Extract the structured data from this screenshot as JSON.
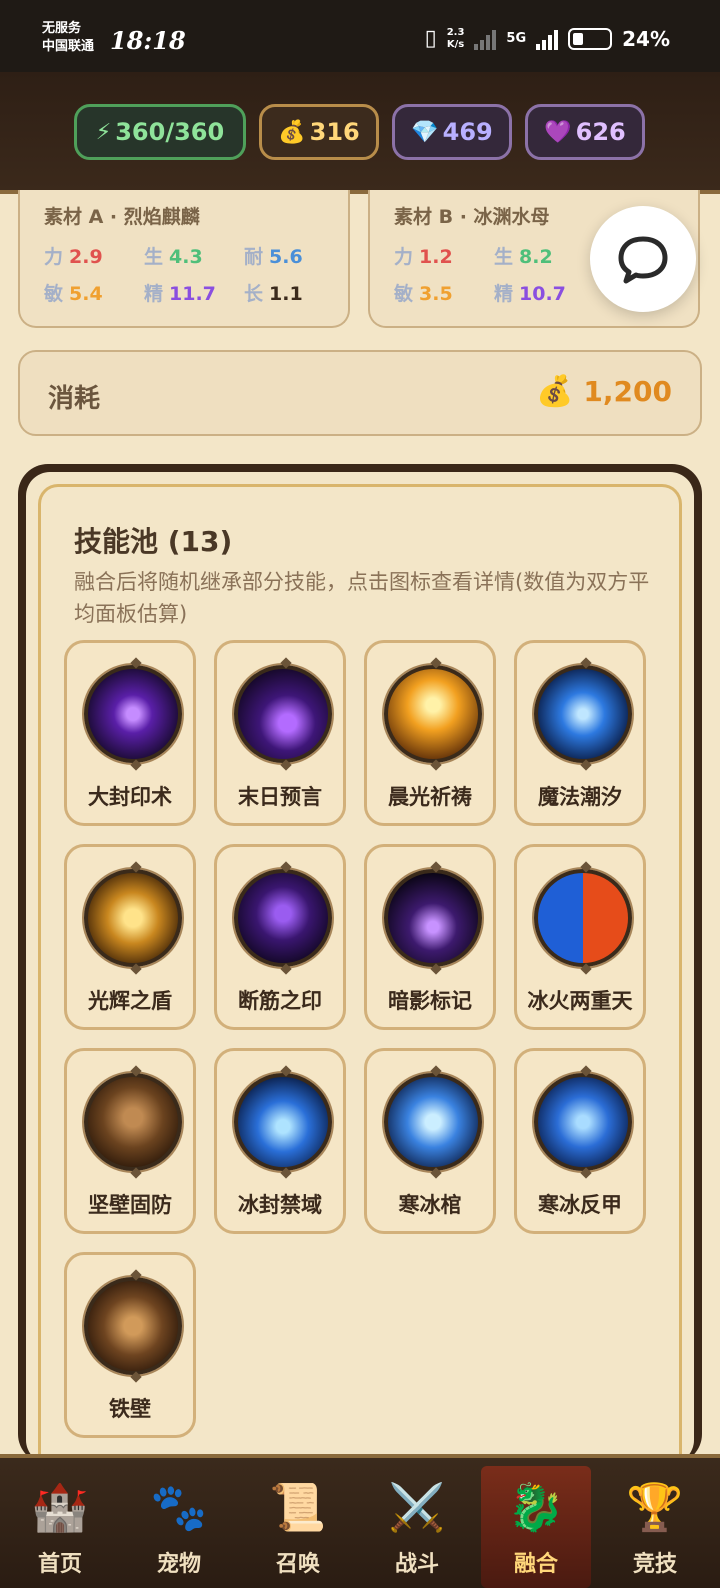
{
  "status_bar": {
    "carrier_line1": "无服务",
    "carrier_line2": "中国联通",
    "time": "18:18",
    "net_speed_value": "2.3",
    "net_speed_unit": "K/s",
    "network_type": "5G",
    "battery": "24%"
  },
  "resources": {
    "energy": {
      "icon": "⚡",
      "value": "360/360"
    },
    "gold": {
      "icon": "💰",
      "value": "316"
    },
    "diamond": {
      "icon": "💎",
      "value": "469"
    },
    "gem": {
      "icon": "💜",
      "value": "626"
    }
  },
  "materials": {
    "a": {
      "title": "素材 A · 烈焰麒麟",
      "stats": [
        {
          "label": "力",
          "value": "2.9"
        },
        {
          "label": "生",
          "value": "4.3"
        },
        {
          "label": "耐",
          "value": "5.6"
        },
        {
          "label": "敏",
          "value": "5.4"
        },
        {
          "label": "精",
          "value": "11.7"
        },
        {
          "label": "长",
          "value": "1.1"
        }
      ]
    },
    "b": {
      "title": "素材 B · 冰渊水母",
      "stats": [
        {
          "label": "力",
          "value": "1.2"
        },
        {
          "label": "生",
          "value": "8.2"
        },
        {
          "label": "敏",
          "value": "3.5"
        },
        {
          "label": "精",
          "value": "10.7"
        }
      ]
    }
  },
  "cost": {
    "label": "消耗",
    "icon": "💰",
    "value": "1,200"
  },
  "skill_pool": {
    "title": "技能池 (13)",
    "description": "融合后将随机继承部分技能，点击图标查看详情(数值为双方平均面板估算)",
    "skills": [
      {
        "name": "大封印术"
      },
      {
        "name": "末日预言"
      },
      {
        "name": "晨光祈祷"
      },
      {
        "name": "魔法潮汐"
      },
      {
        "name": "光辉之盾"
      },
      {
        "name": "断筋之印"
      },
      {
        "name": "暗影标记"
      },
      {
        "name": "冰火两重天"
      },
      {
        "name": "坚壁固防"
      },
      {
        "name": "冰封禁域"
      },
      {
        "name": "寒冰棺"
      },
      {
        "name": "寒冰反甲"
      },
      {
        "name": "铁壁"
      }
    ]
  },
  "nav": {
    "items": [
      {
        "label": "首页",
        "icon": "🏰"
      },
      {
        "label": "宠物",
        "icon": "🐾"
      },
      {
        "label": "召唤",
        "icon": "📜"
      },
      {
        "label": "战斗",
        "icon": "⚔️"
      },
      {
        "label": "融合",
        "icon": "🐉"
      },
      {
        "label": "竞技",
        "icon": "🏆"
      }
    ]
  }
}
